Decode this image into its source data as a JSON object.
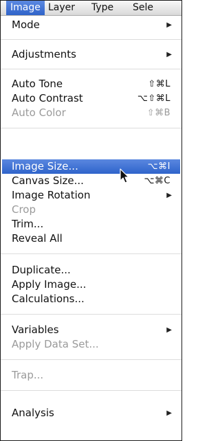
{
  "menubar": {
    "items": [
      {
        "label": "Image",
        "active": true
      },
      {
        "label": "Layer"
      },
      {
        "label": "Type"
      },
      {
        "label": "Sele"
      }
    ]
  },
  "menu": {
    "mode": {
      "label": "Mode",
      "submenu_icon": "triangle-right-icon"
    },
    "adjustments": {
      "label": "Adjustments",
      "submenu_icon": "triangle-right-icon"
    },
    "auto_tone": {
      "label": "Auto Tone",
      "shortcut": "⇧⌘L"
    },
    "auto_contrast": {
      "label": "Auto Contrast",
      "shortcut": "⌥⇧⌘L"
    },
    "auto_color": {
      "label": "Auto Color",
      "shortcut": "⇧⌘B",
      "disabled": true
    },
    "image_size": {
      "label": "Image Size...",
      "shortcut": "⌥⌘I",
      "highlighted": true
    },
    "canvas_size": {
      "label": "Canvas Size...",
      "shortcut": "⌥⌘C"
    },
    "image_rotation": {
      "label": "Image Rotation",
      "submenu_icon": "triangle-right-icon"
    },
    "crop": {
      "label": "Crop",
      "disabled": true
    },
    "trim": {
      "label": "Trim..."
    },
    "reveal_all": {
      "label": "Reveal All"
    },
    "duplicate": {
      "label": "Duplicate..."
    },
    "apply_image": {
      "label": "Apply Image..."
    },
    "calculations": {
      "label": "Calculations..."
    },
    "variables": {
      "label": "Variables",
      "submenu_icon": "triangle-right-icon"
    },
    "apply_data_set": {
      "label": "Apply Data Set...",
      "disabled": true
    },
    "trap": {
      "label": "Trap...",
      "disabled": true
    },
    "analysis": {
      "label": "Analysis",
      "submenu_icon": "triangle-right-icon"
    }
  },
  "colors": {
    "highlight": "#3a6fd4",
    "disabled_text": "#9a9a9a",
    "separator": "#dcdcdc"
  },
  "cursor": {
    "icon": "arrow-cursor-icon"
  }
}
